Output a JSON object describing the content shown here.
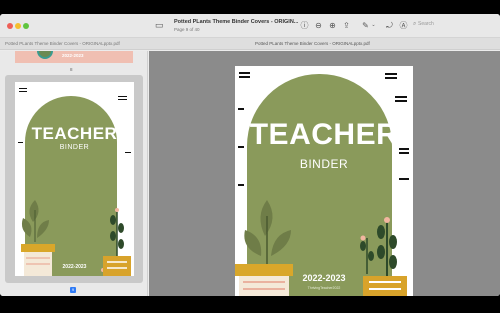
{
  "window": {
    "title": "Potted PLants  Theme Binder Covers - ORIGIN...",
    "subtitle": "Page 9 of 40",
    "tab_left": "Potted PLants  Theme Binder Covers - ORIGINALpptx.pdf",
    "tab_right": "Potted PLants  Theme Binder Covers - ORIGINALpptx.pdf",
    "search_placeholder": "Search"
  },
  "sidebar": {
    "prev_page_label": "8",
    "current_page_label": "9",
    "prev_thumb_year": "2022-2023"
  },
  "cover": {
    "title": "TEACHER",
    "subtitle": "BINDER",
    "year": "2022-2023",
    "shop": "ThrivingTeacher2022"
  },
  "colors": {
    "sage": "#8a9a5b",
    "pot_left": "#d9a72a",
    "pot_right": "#d8a32b",
    "leaf_dark": "#2e4a2a",
    "blush": "#f0bfb2"
  },
  "icons": {
    "sidebar_toggle": "sidebar-icon",
    "info": "info-icon",
    "zoom_out": "zoom-out-icon",
    "zoom_in": "zoom-in-icon",
    "share": "share-icon",
    "markup": "pen-icon",
    "rotate": "rotate-icon",
    "highlight": "highlight-icon",
    "search": "search-icon"
  }
}
